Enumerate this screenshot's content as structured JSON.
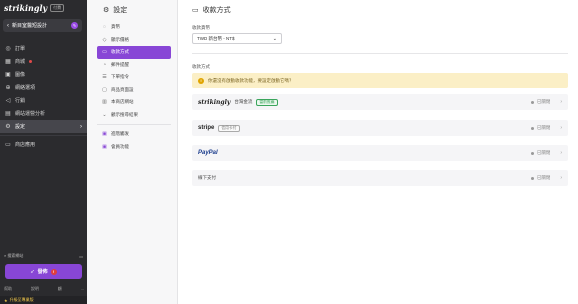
{
  "app": {
    "logo": "strikingly",
    "badge": "付費",
    "site_name": "新目室醫短設計",
    "edit_icon": "pencil-icon"
  },
  "nav": [
    {
      "label": "訂單",
      "icon": "cart-icon"
    },
    {
      "label": "商城",
      "icon": "store-icon",
      "dot": true
    },
    {
      "label": "圖像",
      "icon": "image-icon"
    },
    {
      "label": "網絡選項",
      "icon": "globe-icon"
    },
    {
      "label": "行銷",
      "icon": "megaphone-icon"
    },
    {
      "label": "網站運營分析",
      "icon": "chart-icon"
    },
    {
      "label": "設定",
      "icon": "gear-icon",
      "active": true
    },
    {
      "label": "商店應用",
      "icon": "apps-icon"
    }
  ],
  "tools": {
    "left": "搜索網站",
    "right_icon": "monitor-icon"
  },
  "publish": {
    "label": "發佈",
    "warn": "!"
  },
  "footer_links": [
    "幫助",
    "說明",
    "顧",
    "..."
  ],
  "upgrade": "升級至專業版",
  "settings": {
    "title": "設定",
    "items": [
      {
        "label": "貨幣",
        "icon": "coin-icon"
      },
      {
        "label": "顯示價格",
        "icon": "tag-icon"
      },
      {
        "label": "收款方式",
        "icon": "card-icon",
        "active": true
      },
      {
        "label": "郵件提醒",
        "icon": "bell-icon"
      },
      {
        "label": "下單指令",
        "icon": "list-icon"
      },
      {
        "label": "商品頁面設",
        "icon": "page-icon"
      },
      {
        "label": "本商店網站",
        "icon": "shop-icon"
      },
      {
        "label": "顧示搜尋結果",
        "icon": "chevron-down-icon"
      },
      {
        "label": "進階觸发",
        "icon": "zap-icon",
        "purple": true
      },
      {
        "label": "會員功能",
        "icon": "user-icon",
        "purple": true
      }
    ]
  },
  "main": {
    "title": "收款方式",
    "currency_label": "收款貨幣",
    "currency_value": "TWD 新台幣 - NT$",
    "methods_label": "收款方式",
    "alert": "你還沒有啟動收款功能，要設定啟動它嗎？",
    "payments": [
      {
        "name": "strikingly",
        "suffix": "台灣金流",
        "tag": "當前推薦",
        "tag_style": "green",
        "status": "已關閉",
        "logo": "strikingly"
      },
      {
        "name": "stripe",
        "suffix": "",
        "tag": "信用卡付",
        "tag_style": "gray",
        "status": "已關閉",
        "logo": "stripe"
      },
      {
        "name": "PayPal",
        "suffix": "",
        "tag": "",
        "tag_style": "",
        "status": "已關閉",
        "logo": "paypal"
      },
      {
        "name": "線下支付",
        "suffix": "",
        "tag": "",
        "tag_style": "",
        "status": "已關閉",
        "logo": "text"
      }
    ]
  }
}
